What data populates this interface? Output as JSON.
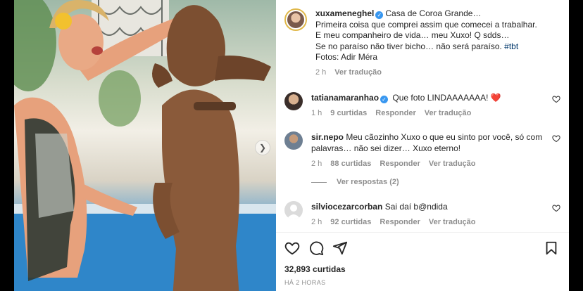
{
  "post": {
    "author": "xuxameneghel",
    "caption_lines": [
      "Casa de Coroa Grande…",
      "Primeira coisa que comprei assim que comecei a trabalhar.",
      "E meu companheiro de vida… meu Xuxo! Q sdds…",
      "Se no paraíso não tiver bicho… não será paraíso.",
      "Fotos: Adir Méra"
    ],
    "hashtag": "#tbt",
    "time": "2 h",
    "see_translation": "Ver tradução"
  },
  "comments": [
    {
      "username": "tatianamaranhao",
      "verified": true,
      "text": "Que foto LINDAAAAAAA!",
      "emoji": "❤️",
      "time": "1 h",
      "likes": "9 curtidas",
      "reply": "Responder",
      "translate": "Ver tradução"
    },
    {
      "username": "sir.nepo",
      "verified": false,
      "text": "Meu cãozinho Xuxo o que eu sinto por você, só com palavras… não sei dizer… Xuxo eterno!",
      "time": "2 h",
      "likes": "88 curtidas",
      "reply": "Responder",
      "translate": "Ver tradução",
      "view_replies": "Ver respostas (2)"
    },
    {
      "username": "silviocezarcorban",
      "verified": false,
      "text": "Sai daí b@ndida",
      "time": "2 h",
      "likes": "92 curtidas",
      "reply": "Responder",
      "translate": "Ver tradução"
    }
  ],
  "footer": {
    "likes": "32,893 curtidas",
    "time_ago": "HÁ 2 HORAS"
  },
  "icons": {
    "like": "heart-icon",
    "comment": "comment-icon",
    "share": "send-icon",
    "save": "bookmark-icon",
    "carousel": "chevron-right-icon"
  },
  "colors": {
    "verified": "#3897f0",
    "hashtag": "#00376b",
    "muted": "#8e8e8e",
    "heart": "#ed4956"
  }
}
